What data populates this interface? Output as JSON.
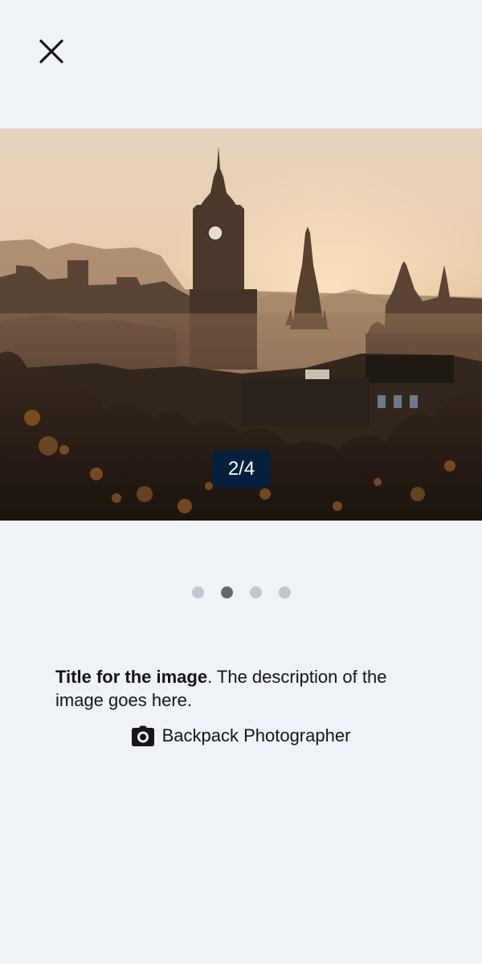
{
  "close": {
    "icon": "close-icon",
    "label": "Close"
  },
  "gallery": {
    "counter": "2/4",
    "current_index": 2,
    "total": 4,
    "dots": [
      {
        "active": false
      },
      {
        "active": true
      },
      {
        "active": false
      },
      {
        "active": false
      }
    ]
  },
  "caption": {
    "title": "Title for the image",
    "description": ". The description of the image goes here."
  },
  "credit": {
    "icon": "camera-icon",
    "photographer": "Backpack Photographer"
  },
  "colors": {
    "background": "#eff2f6",
    "counter_bg": "#05203c",
    "dot_active": "#626971",
    "dot_inactive": "#c1c7cf",
    "text": "#161616"
  }
}
